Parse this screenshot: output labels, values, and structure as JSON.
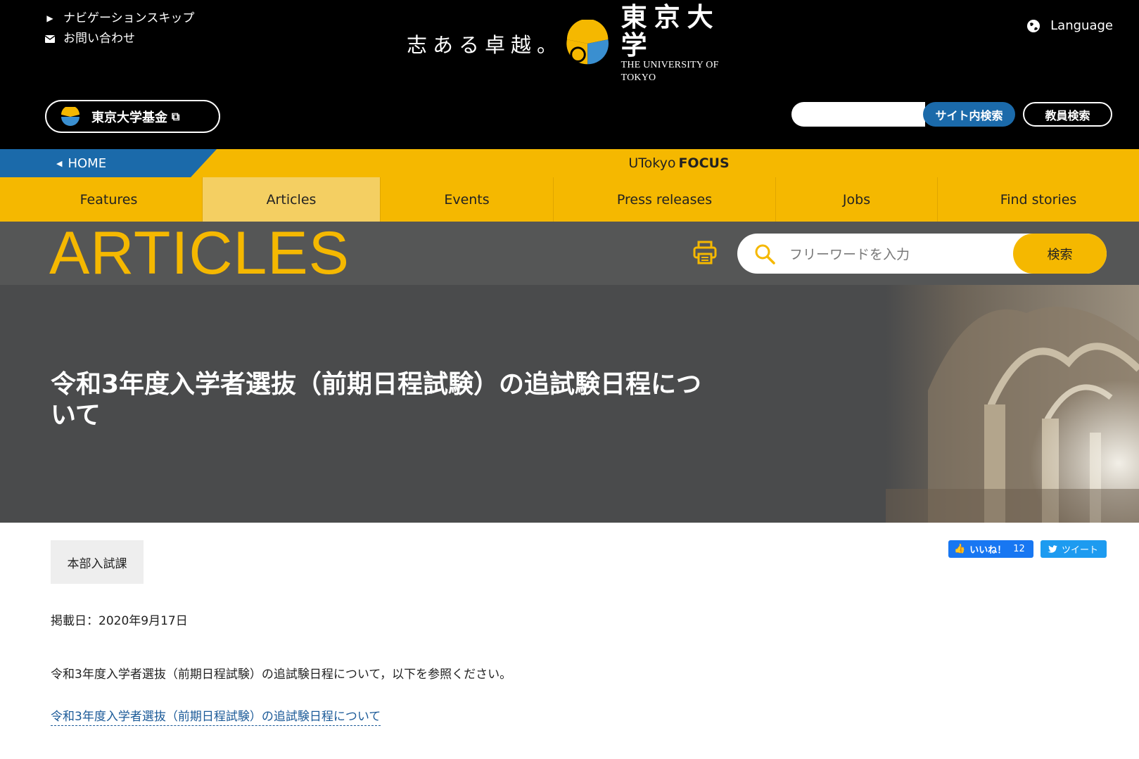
{
  "header": {
    "skip_nav": "ナビゲーションスキップ",
    "contact": "お問い合わせ",
    "tagline": "志ある卓越。",
    "univ_jp": "東京大学",
    "univ_en": "THE UNIVERSITY OF TOKYO",
    "language": "Language",
    "fund": "東京大学基金",
    "site_search_btn": "サイト内検索",
    "staff_search_btn": "教員検索"
  },
  "bar": {
    "home": "HOME",
    "focus_pre": "UTokyo",
    "focus_bold": "FOCUS"
  },
  "nav": {
    "items": [
      "Features",
      "Articles",
      "Events",
      "Press releases",
      "Jobs",
      "Find stories"
    ],
    "active": "Articles"
  },
  "section": {
    "title": "ARTICLES",
    "search_placeholder": "フリーワードを入力",
    "search_btn": "検索"
  },
  "article": {
    "title": "令和3年度入学者選抜（前期日程試験）の追試験日程について",
    "tag": "本部入試課",
    "date": "掲載日：2020年9月17日",
    "body": "令和3年度入学者選抜（前期日程試験）の追試験日程について，以下を参照ください。",
    "link": "令和3年度入学者選抜（前期日程試験）の追試験日程について"
  },
  "social": {
    "like": "いいね！",
    "like_count": "12",
    "tweet": "ツイート"
  },
  "colors": {
    "accent_yellow": "#f5b800",
    "accent_blue": "#1b6aaa",
    "band_gray": "#555656"
  }
}
